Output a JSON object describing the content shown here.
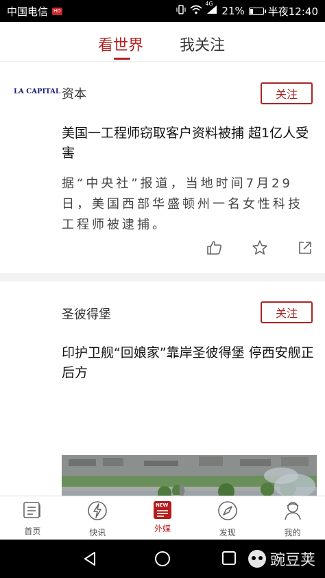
{
  "status_bar": {
    "carrier": "中国电信",
    "carrier_badge": "HD",
    "network": "4G",
    "battery": "21%",
    "battery_level": 0.21,
    "time": "半夜12:40"
  },
  "top_tabs": [
    {
      "label": "看世界",
      "active": true
    },
    {
      "label": "我关注",
      "active": false
    }
  ],
  "feed": [
    {
      "source_logo_text": "LA CAPITAL",
      "source_name": "资本",
      "follow_label": "关注",
      "title": "美国一工程师窃取客户资料被捕 超1亿人受害",
      "summary": "据“中央社”报道，当地时间7月29日，美国西部华盛顿州一名女性科技工程师被逮捕。",
      "actions": [
        "thumbs-up-icon",
        "star-icon",
        "share-icon"
      ]
    },
    {
      "source_name": "圣彼得堡",
      "follow_label": "关注",
      "title": "印护卫舰“回娘家”靠岸圣彼得堡 停西安舰正后方",
      "image_label": "warship-photo"
    }
  ],
  "bottom_nav": [
    {
      "label": "首页",
      "icon": "book-icon",
      "active": false
    },
    {
      "label": "快讯",
      "icon": "lightning-icon",
      "active": false
    },
    {
      "label": "外媒",
      "icon": "new-badge-icon",
      "badge": "NEW",
      "active": true
    },
    {
      "label": "发现",
      "icon": "compass-icon",
      "active": false
    },
    {
      "label": "我的",
      "icon": "person-icon",
      "active": false
    }
  ],
  "watermark": "豌豆荚",
  "colors": {
    "accent": "#b71c1c",
    "follow_border": "#a72624"
  }
}
